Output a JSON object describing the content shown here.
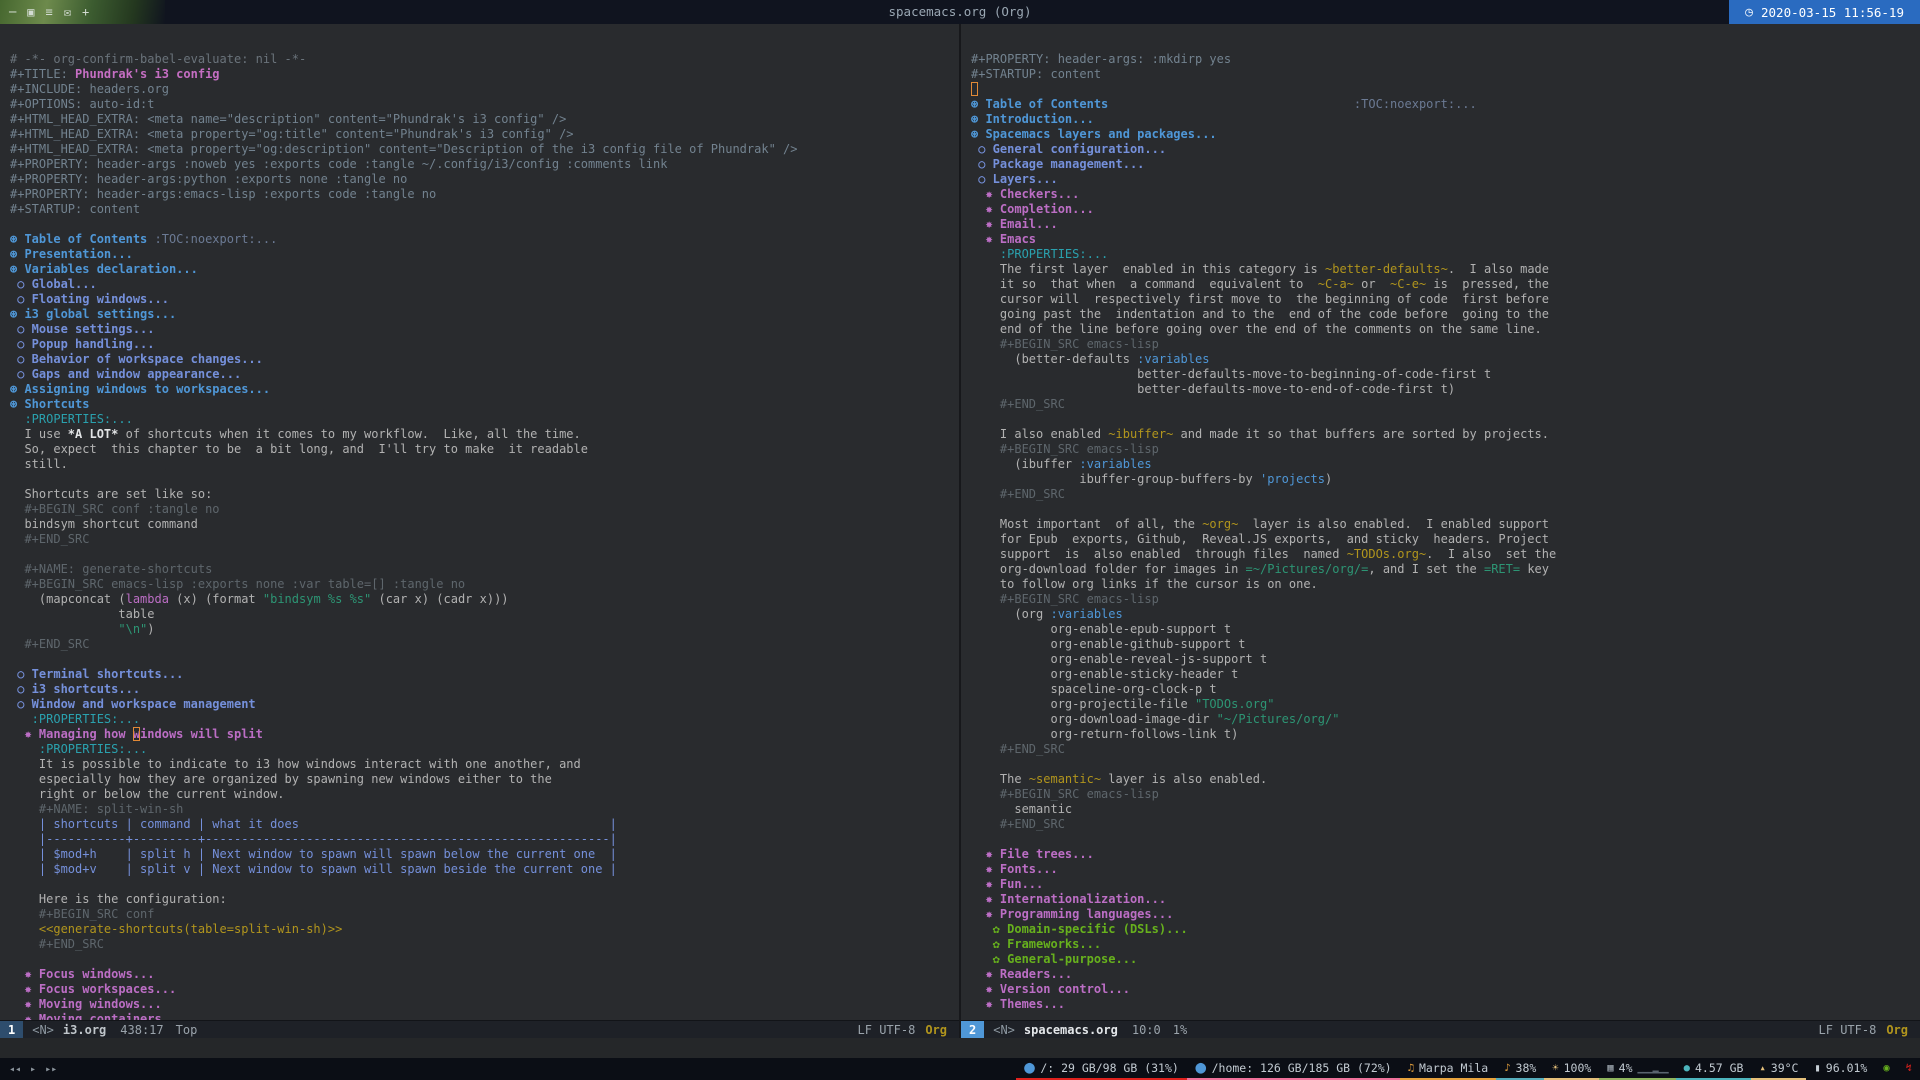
{
  "titlebar": {
    "icons": [
      {
        "name": "minimize",
        "glyph": "─"
      },
      {
        "name": "window",
        "glyph": "▣"
      },
      {
        "name": "menu",
        "glyph": "≡"
      },
      {
        "name": "mail",
        "glyph": "✉"
      },
      {
        "name": "plus",
        "glyph": "+"
      }
    ],
    "title": "spacemacs.org (Org)",
    "clock_icon": "◷",
    "clock": "2020-03-15 11:56-19",
    "clock_bg": "#2a6bc0"
  },
  "editor": {
    "left": {
      "modeline": {
        "win": "1",
        "state": "<N>",
        "buffer": "i3.org",
        "pos": "438:17",
        "scroll": "Top",
        "encoding": "LF UTF-8",
        "mode": "Org"
      },
      "lines": [
        [
          [
            "cm",
            "# -*- org-confirm-babel-evaluate: nil -*-"
          ]
        ],
        [
          [
            "meta",
            "#+TITLE: "
          ],
          [
            "ttl",
            "Phundrak's i3 config"
          ]
        ],
        [
          [
            "meta",
            "#+INCLUDE: headers.org"
          ]
        ],
        [
          [
            "meta",
            "#+OPTIONS: auto-id:t"
          ]
        ],
        [
          [
            "meta",
            "#+HTML_HEAD_EXTRA: <meta name=\"description\" content=\"Phundrak's i3 config\" />"
          ]
        ],
        [
          [
            "meta",
            "#+HTML_HEAD_EXTRA: <meta property=\"og:title\" content=\"Phundrak's i3 config\" />"
          ]
        ],
        [
          [
            "meta",
            "#+HTML_HEAD_EXTRA: <meta property=\"og:description\" content=\"Description of the i3 config file of Phundrak\" />"
          ]
        ],
        [
          [
            "meta",
            "#+PROPERTY: header-args :noweb yes :exports code :tangle ~/.config/i3/config :comments link"
          ]
        ],
        [
          [
            "meta",
            "#+PROPERTY: header-args:python :exports none :tangle no"
          ]
        ],
        [
          [
            "meta",
            "#+PROPERTY: header-args:emacs-lisp :exports code :tangle no"
          ]
        ],
        [
          [
            "meta",
            "#+STARTUP: content"
          ]
        ],
        [],
        [
          [
            "h1",
            "⊛ Table of Contents "
          ],
          [
            "tag",
            ":TOC:noexport:..."
          ]
        ],
        [
          [
            "h1",
            "⊛ Presentation..."
          ]
        ],
        [
          [
            "h1",
            "⊛ Variables declaration..."
          ]
        ],
        [
          [
            "h2",
            " ○ Global..."
          ]
        ],
        [
          [
            "h2",
            " ○ Floating windows..."
          ]
        ],
        [
          [
            "h1",
            "⊛ i3 global settings..."
          ]
        ],
        [
          [
            "h2",
            " ○ Mouse settings..."
          ]
        ],
        [
          [
            "h2",
            " ○ Popup handling..."
          ]
        ],
        [
          [
            "h2",
            " ○ Behavior of workspace changes..."
          ]
        ],
        [
          [
            "h2",
            " ○ Gaps and window appearance..."
          ]
        ],
        [
          [
            "h1",
            "⊛ Assigning windows to workspaces..."
          ]
        ],
        [
          [
            "h1",
            "⊛ Shortcuts"
          ]
        ],
        [
          [
            "drw",
            "  :PROPERTIES:..."
          ]
        ],
        [
          [
            "txt",
            "  I use "
          ],
          [
            "b",
            "*A LOT*"
          ],
          [
            "txt",
            " of shortcuts when it comes to my workflow.  Like, all the time."
          ]
        ],
        [
          [
            "txt",
            "  So, expect  this chapter to be  a bit long, and  I'll try to make  it readable"
          ]
        ],
        [
          [
            "txt",
            "  still."
          ]
        ],
        [],
        [
          [
            "txt",
            "  Shortcuts are set like so:"
          ]
        ],
        [
          [
            "src",
            "  #+BEGIN_SRC conf :tangle no"
          ]
        ],
        [
          [
            "txt",
            "  bindsym shortcut command"
          ]
        ],
        [
          [
            "src",
            "  #+END_SRC"
          ]
        ],
        [],
        [
          [
            "src",
            "  #+NAME: generate-shortcuts"
          ]
        ],
        [
          [
            "src",
            "  #+BEGIN_SRC emacs-lisp :exports none :var table=[] :tangle no"
          ]
        ],
        [
          [
            "txt",
            "    (mapconcat ("
          ],
          [
            "fn",
            "lambda"
          ],
          [
            "txt",
            " (x) (format "
          ],
          [
            "str",
            "\"bindsym %s %s\""
          ],
          [
            "txt",
            " (car x) (cadr x)))"
          ]
        ],
        [
          [
            "txt",
            "               table"
          ]
        ],
        [
          [
            "txt",
            "               "
          ],
          [
            "str",
            "\"\\n\""
          ],
          [
            "txt",
            ")"
          ]
        ],
        [
          [
            "src",
            "  #+END_SRC"
          ]
        ],
        [],
        [
          [
            "h2",
            " ○ Terminal shortcuts..."
          ]
        ],
        [
          [
            "h2",
            " ○ i3 shortcuts..."
          ]
        ],
        [
          [
            "h2",
            " ○ Window and workspace management"
          ]
        ],
        [
          [
            "drw",
            "   :PROPERTIES:..."
          ]
        ],
        [
          [
            "h3",
            "  ✸ Managing how "
          ],
          [
            "h3 curh",
            "w"
          ],
          [
            "h3",
            "indows will split"
          ]
        ],
        [
          [
            "drw",
            "    :PROPERTIES:..."
          ]
        ],
        [
          [
            "txt",
            "    It is possible to indicate to i3 how windows interact with one another, and"
          ]
        ],
        [
          [
            "txt",
            "    especially how they are organized by spawning new windows either to the"
          ]
        ],
        [
          [
            "txt",
            "    right or below the current window."
          ]
        ],
        [
          [
            "src",
            "    #+NAME: split-win-sh"
          ]
        ],
        [
          [
            "tbl",
            "    | shortcuts | command | what it does                                           |"
          ]
        ],
        [
          [
            "tbl",
            "    |-----------+---------+--------------------------------------------------------|"
          ]
        ],
        [
          [
            "tbl",
            "    | $mod+h    | split h | Next window to spawn will spawn below the current one  |"
          ]
        ],
        [
          [
            "tbl",
            "    | $mod+v    | split v | Next window to spawn will spawn beside the current one |"
          ]
        ],
        [],
        [
          [
            "txt",
            "    Here is the configuration:"
          ]
        ],
        [
          [
            "src",
            "    #+BEGIN_SRC conf"
          ]
        ],
        [
          [
            "nw",
            "    <<generate-shortcuts(table=split-win-sh)>>"
          ]
        ],
        [
          [
            "src",
            "    #+END_SRC"
          ]
        ],
        [],
        [
          [
            "h3",
            "  ✸ Focus windows..."
          ]
        ],
        [
          [
            "h3",
            "  ✸ Focus workspaces..."
          ]
        ],
        [
          [
            "h3",
            "  ✸ Moving windows..."
          ]
        ],
        [
          [
            "h3",
            "  ✸ Moving containers..."
          ]
        ]
      ]
    },
    "right": {
      "modeline": {
        "win": "2",
        "state": "<N>",
        "buffer": "spacemacs.org",
        "pos": "10:0",
        "scroll": "1%",
        "encoding": "LF UTF-8",
        "mode": "Org"
      },
      "lines": [
        [
          [
            "meta",
            "#+PROPERTY: header-args: :mkdirp yes"
          ]
        ],
        [
          [
            "meta",
            "#+STARTUP: content"
          ]
        ],
        [
          [
            "curh",
            " "
          ]
        ],
        [
          [
            "h1",
            "⊛ Table of Contents"
          ],
          [
            "txt",
            "                                  "
          ],
          [
            "tag",
            ":TOC:noexport:..."
          ]
        ],
        [
          [
            "h1",
            "⊛ Introduction..."
          ]
        ],
        [
          [
            "h1",
            "⊛ Spacemacs layers and packages..."
          ]
        ],
        [
          [
            "h2",
            " ○ General configuration..."
          ]
        ],
        [
          [
            "h2",
            " ○ Package management..."
          ]
        ],
        [
          [
            "h2",
            " ○ Layers..."
          ]
        ],
        [
          [
            "h3",
            "  ✸ Checkers..."
          ]
        ],
        [
          [
            "h3",
            "  ✸ Completion..."
          ]
        ],
        [
          [
            "h3",
            "  ✸ Email..."
          ]
        ],
        [
          [
            "h3",
            "  ✸ Emacs"
          ]
        ],
        [
          [
            "drw",
            "    :PROPERTIES:..."
          ]
        ],
        [
          [
            "txt",
            "    The first layer  enabled in this category is "
          ],
          [
            "cod",
            "~better-defaults~"
          ],
          [
            "txt",
            ".  I also made"
          ]
        ],
        [
          [
            "txt",
            "    it so  that when  a command  equivalent to  "
          ],
          [
            "cod",
            "~C-a~"
          ],
          [
            "txt",
            " or  "
          ],
          [
            "cod",
            "~C-e~"
          ],
          [
            "txt",
            " is  pressed, the"
          ]
        ],
        [
          [
            "txt",
            "    cursor will  respectively first move to  the beginning of code  first before"
          ]
        ],
        [
          [
            "txt",
            "    going past the  indentation and to the  end of the code before  going to the"
          ]
        ],
        [
          [
            "txt",
            "    end of the line before going over the end of the comments on the same line."
          ]
        ],
        [
          [
            "src",
            "    #+BEGIN_SRC emacs-lisp"
          ]
        ],
        [
          [
            "txt",
            "      (better-defaults "
          ],
          [
            "kwd",
            ":variables"
          ]
        ],
        [
          [
            "txt",
            "                       better-defaults-move-to-beginning-of-code-first t"
          ]
        ],
        [
          [
            "txt",
            "                       better-defaults-move-to-end-of-code-first t)"
          ]
        ],
        [
          [
            "src",
            "    #+END_SRC"
          ]
        ],
        [],
        [
          [
            "txt",
            "    I also enabled "
          ],
          [
            "cod",
            "~ibuffer~"
          ],
          [
            "txt",
            " and made it so that buffers are sorted by projects."
          ]
        ],
        [
          [
            "src",
            "    #+BEGIN_SRC emacs-lisp"
          ]
        ],
        [
          [
            "txt",
            "      (ibuffer "
          ],
          [
            "kwd",
            ":variables"
          ]
        ],
        [
          [
            "txt",
            "               ibuffer-group-buffers-by "
          ],
          [
            "qt",
            "'projects"
          ],
          [
            "txt",
            ")"
          ]
        ],
        [
          [
            "src",
            "    #+END_SRC"
          ]
        ],
        [],
        [
          [
            "txt",
            "    Most important  of all, the "
          ],
          [
            "cod",
            "~org~"
          ],
          [
            "txt",
            "  layer is also enabled.  I enabled support"
          ]
        ],
        [
          [
            "txt",
            "    for Epub  exports, Github,  Reveal.JS exports,  and sticky  headers. Project"
          ]
        ],
        [
          [
            "txt",
            "    support  is  also enabled  through files  named "
          ],
          [
            "cod",
            "~TODOs.org~"
          ],
          [
            "txt",
            ".  I also  set the"
          ]
        ],
        [
          [
            "txt",
            "    org-download folder for images in "
          ],
          [
            "vrb",
            "=~/Pictures/org/="
          ],
          [
            "txt",
            ", and I set the "
          ],
          [
            "vrb",
            "=RET="
          ],
          [
            "txt",
            " key"
          ]
        ],
        [
          [
            "txt",
            "    to follow org links if the cursor is on one."
          ]
        ],
        [
          [
            "src",
            "    #+BEGIN_SRC emacs-lisp"
          ]
        ],
        [
          [
            "txt",
            "      (org "
          ],
          [
            "kwd",
            ":variables"
          ]
        ],
        [
          [
            "txt",
            "           org-enable-epub-support t"
          ]
        ],
        [
          [
            "txt",
            "           org-enable-github-support t"
          ]
        ],
        [
          [
            "txt",
            "           org-enable-reveal-js-support t"
          ]
        ],
        [
          [
            "txt",
            "           org-enable-sticky-header t"
          ]
        ],
        [
          [
            "txt",
            "           spaceline-org-clock-p t"
          ]
        ],
        [
          [
            "txt",
            "           org-projectile-file "
          ],
          [
            "str",
            "\"TODOs.org\""
          ]
        ],
        [
          [
            "txt",
            "           org-download-image-dir "
          ],
          [
            "str",
            "\"~/Pictures/org/\""
          ]
        ],
        [
          [
            "txt",
            "           org-return-follows-link t)"
          ]
        ],
        [
          [
            "src",
            "    #+END_SRC"
          ]
        ],
        [],
        [
          [
            "txt",
            "    The "
          ],
          [
            "cod",
            "~semantic~"
          ],
          [
            "txt",
            " layer is also enabled."
          ]
        ],
        [
          [
            "src",
            "    #+BEGIN_SRC emacs-lisp"
          ]
        ],
        [
          [
            "txt",
            "      semantic"
          ]
        ],
        [
          [
            "src",
            "    #+END_SRC"
          ]
        ],
        [],
        [
          [
            "h3",
            "  ✸ File trees..."
          ]
        ],
        [
          [
            "h3",
            "  ✸ Fonts..."
          ]
        ],
        [
          [
            "h3",
            "  ✸ Fun..."
          ]
        ],
        [
          [
            "h3",
            "  ✸ Internationalization..."
          ]
        ],
        [
          [
            "h3",
            "  ✸ Programming languages..."
          ]
        ],
        [
          [
            "h4",
            "   ✿ Domain-specific (DSLs)..."
          ]
        ],
        [
          [
            "h4",
            "   ✿ Frameworks..."
          ]
        ],
        [
          [
            "h4",
            "   ✿ General-purpose..."
          ]
        ],
        [
          [
            "h3",
            "  ✸ Readers..."
          ]
        ],
        [
          [
            "h3",
            "  ✸ Version control..."
          ]
        ],
        [
          [
            "h3",
            "  ✸ Themes..."
          ]
        ]
      ]
    }
  },
  "systembar": {
    "media": [
      {
        "name": "previous",
        "glyph": "◂◂"
      },
      {
        "name": "play",
        "glyph": "▸"
      },
      {
        "name": "next",
        "glyph": "▸▸"
      }
    ],
    "modules": [
      {
        "name": "disk-root",
        "icon": "⬤",
        "icon_color": "#4f97d7",
        "text": "/: 29 GB/98 GB (31%)",
        "underline": "#e0211d"
      },
      {
        "name": "disk-home",
        "icon": "⬤",
        "icon_color": "#4f97d7",
        "text": "/home: 126 GB/185 GB (72%)",
        "underline": "#f0719b"
      },
      {
        "name": "music",
        "icon": "♫",
        "icon_color": "#e8a33d",
        "text": "Marpa Mila",
        "underline": "#e8a33d"
      },
      {
        "name": "volume",
        "icon": "♪",
        "icon_color": "#e8a33d",
        "text": "38%",
        "underline": "#56adbc"
      },
      {
        "name": "brightness",
        "icon": "☀",
        "icon_color": "#e5c07b",
        "text": "100%",
        "underline": "#e5c07b"
      },
      {
        "name": "cpu",
        "icon": "▦",
        "icon_color": "#9aa3ab",
        "text": "4%",
        "graph": "▁▁▁▂▁▁",
        "underline": "#8fb55e"
      },
      {
        "name": "memory",
        "icon": "●",
        "icon_color": "#4db5bd",
        "text": "4.57 GB",
        "underline": "#4db5bd"
      },
      {
        "name": "temperature",
        "icon": "▴",
        "icon_color": "#e5c07b",
        "text": "39°C",
        "underline": "#e5c07b"
      },
      {
        "name": "battery",
        "icon": "▮",
        "icon_color": "#c8d0d7",
        "text": "96.01%",
        "underline": ""
      },
      {
        "name": "battery-status",
        "icon": "◉",
        "icon_color": "#67b11d",
        "text": "",
        "underline": ""
      },
      {
        "name": "power-alert",
        "icon": "↯",
        "icon_color": "#e0211d",
        "text": "",
        "underline": ""
      }
    ]
  },
  "colors": {
    "editor_bg": "#292b2e",
    "modeline_bg": "#1e2127",
    "titlebar_bg": "#10141f",
    "systembar_bg": "#0b0e15",
    "accent_blue": "#4f97d7",
    "cursor_orange": "#e18936"
  }
}
